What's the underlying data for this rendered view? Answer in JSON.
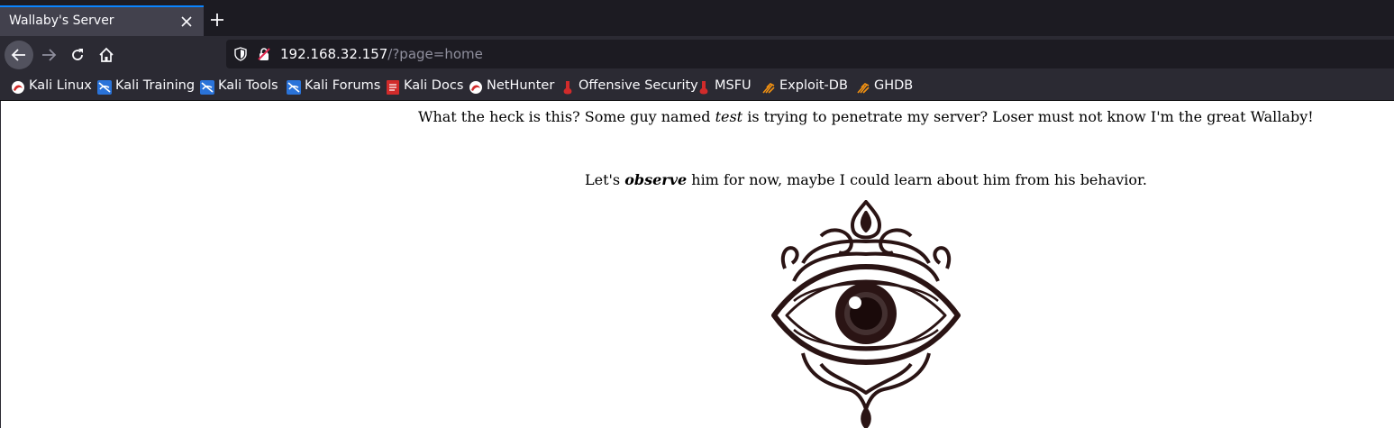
{
  "browser": {
    "tab": {
      "title": "Wallaby's Server"
    },
    "url": {
      "host": "192.168.32.157",
      "path": "/?page=home"
    },
    "bookmarks": [
      {
        "label": "Kali Linux",
        "icon": "kali-dragon-icon"
      },
      {
        "label": "Kali Training",
        "icon": "kali-training-icon"
      },
      {
        "label": "Kali Tools",
        "icon": "kali-tools-icon"
      },
      {
        "label": "Kali Forums",
        "icon": "kali-forums-icon"
      },
      {
        "label": "Kali Docs",
        "icon": "kali-docs-icon"
      },
      {
        "label": "NetHunter",
        "icon": "nethunter-icon"
      },
      {
        "label": "Offensive Security",
        "icon": "offsec-icon"
      },
      {
        "label": "MSFU",
        "icon": "msfu-icon"
      },
      {
        "label": "Exploit-DB",
        "icon": "exploit-db-icon"
      },
      {
        "label": "GHDB",
        "icon": "ghdb-icon"
      }
    ]
  },
  "page": {
    "line1": {
      "before": "What the heck is this? Some guy named ",
      "emphasis": "test",
      "after": " is trying to penetrate my server? Loser must not know I'm the great Wallaby!"
    },
    "line2": {
      "before": "Let's ",
      "emphasis": "observe",
      "after": " him for now, maybe I could learn about him from his behavior."
    },
    "image": {
      "icon": "all-seeing-eye-illustration"
    }
  },
  "colors": {
    "tab_accent": "#0a84ff",
    "toolbar_bg": "#2b2a33",
    "tabstrip_bg": "#1c1b22",
    "eye_ink": "#2a1414"
  }
}
